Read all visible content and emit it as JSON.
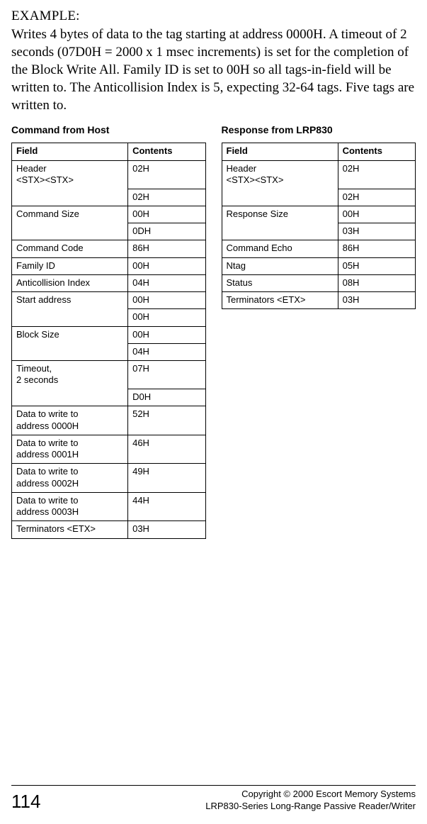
{
  "heading": "EXAMPLE:",
  "intro": "Writes 4 bytes of data to the tag starting at address 0000H. A timeout of 2 seconds (07D0H = 2000 x 1 msec increments) is set for the completion of the Block Write All. Family ID is set to 00H so all tags-in-field will be written to.  The Anticollision Index is 5, expecting 32-64 tags.  Five tags are written to.",
  "left": {
    "title": "Command from Host",
    "headers": {
      "field": "Field",
      "contents": "Contents"
    },
    "rows": [
      {
        "field": "Header\n<STX><STX>",
        "contents": "02H",
        "merge": "start"
      },
      {
        "field": "",
        "contents": "02H",
        "merge": "end"
      },
      {
        "field": "Command Size",
        "contents": "00H",
        "merge": "start"
      },
      {
        "field": "",
        "contents": "0DH",
        "merge": "end"
      },
      {
        "field": "Command Code",
        "contents": "86H"
      },
      {
        "field": "Family ID",
        "contents": "00H"
      },
      {
        "field": "Anticollision Index",
        "contents": "04H"
      },
      {
        "field": "Start address",
        "contents": "00H",
        "merge": "start"
      },
      {
        "field": "",
        "contents": "00H",
        "merge": "end"
      },
      {
        "field": "Block Size",
        "contents": "00H",
        "merge": "start"
      },
      {
        "field": "",
        "contents": "04H",
        "merge": "end"
      },
      {
        "field": "Timeout,\n2 seconds",
        "contents": "07H",
        "merge": "start"
      },
      {
        "field": "",
        "contents": "D0H",
        "merge": "end"
      },
      {
        "field": "Data to write to\naddress 0000H",
        "contents": "52H"
      },
      {
        "field": "Data to write to\naddress 0001H",
        "contents": "46H"
      },
      {
        "field": "Data to write to\naddress 0002H",
        "contents": "49H"
      },
      {
        "field": "Data to write to\naddress 0003H",
        "contents": "44H"
      },
      {
        "field": "Terminators <ETX>",
        "contents": "03H"
      }
    ]
  },
  "right": {
    "title": "Response from LRP830",
    "headers": {
      "field": "Field",
      "contents": "Contents"
    },
    "rows": [
      {
        "field": "Header\n<STX><STX>",
        "contents": "02H",
        "merge": "start"
      },
      {
        "field": "",
        "contents": "02H",
        "merge": "end"
      },
      {
        "field": "Response Size",
        "contents": "00H",
        "merge": "start"
      },
      {
        "field": "",
        "contents": "03H",
        "merge": "end"
      },
      {
        "field": "Command Echo",
        "contents": "86H"
      },
      {
        "field": "Ntag",
        "contents": "05H"
      },
      {
        "field": "Status",
        "contents": "08H"
      },
      {
        "field": "Terminators <ETX>",
        "contents": "03H"
      }
    ]
  },
  "footer": {
    "page": "114",
    "line1": "Copyright © 2000 Escort Memory Systems",
    "line2": "LRP830-Series Long-Range Passive Reader/Writer"
  }
}
